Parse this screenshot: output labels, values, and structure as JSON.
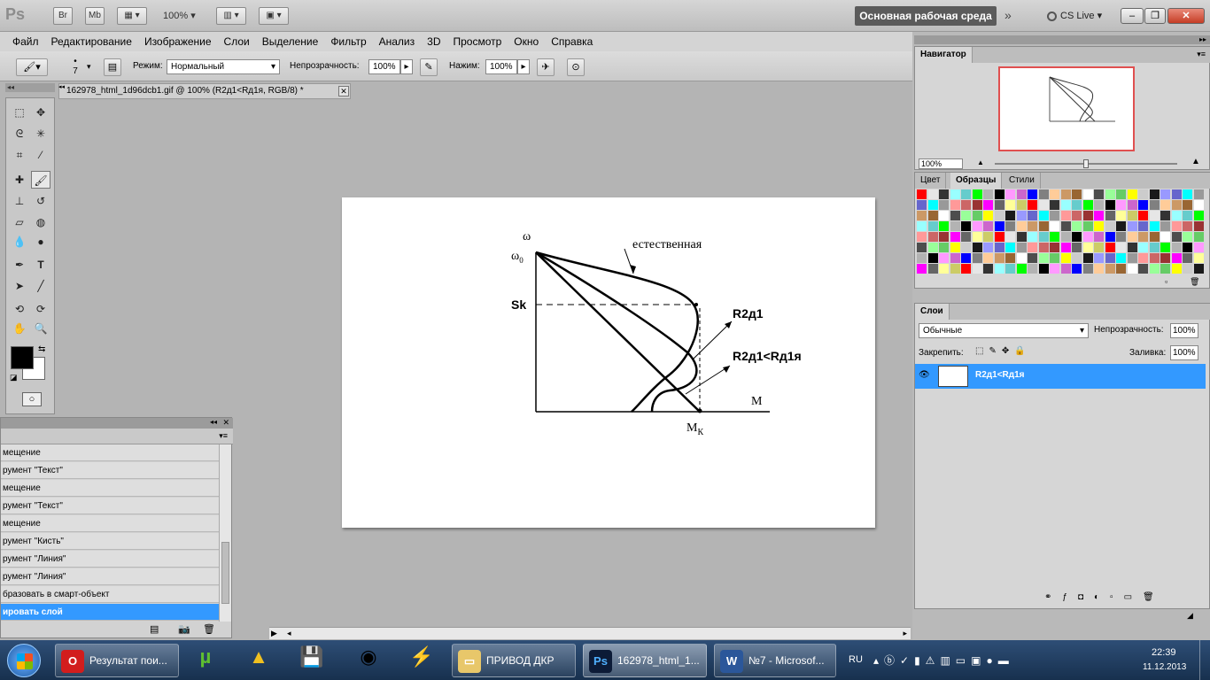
{
  "appbar": {
    "logo": "Ps",
    "btn_br": "Br",
    "btn_mb": "Mb",
    "zoom": "100%",
    "workspace": "Основная рабочая среда",
    "cslive": "CS Live"
  },
  "menu": [
    "Файл",
    "Редактирование",
    "Изображение",
    "Слои",
    "Выделение",
    "Фильтр",
    "Анализ",
    "3D",
    "Просмотр",
    "Окно",
    "Справка"
  ],
  "options": {
    "brush_size": "7",
    "mode_label": "Режим:",
    "mode_value": "Нормальный",
    "opacity_label": "Непрозрачность:",
    "opacity_value": "100%",
    "pressure_label": "Нажим:",
    "pressure_value": "100%"
  },
  "document": {
    "tab_title": "162978_html_1d96dcb1.gif @ 100% (R2д1<Rд1я, RGB/8) *"
  },
  "figure": {
    "omega": "ω",
    "omega0_main": "ω",
    "omega0_sub": "0",
    "natural": "естественная",
    "sk": "Sk",
    "r2d1": "R2д1",
    "r2d1_lt": "R2д1<Rд1я",
    "m_axis": "M",
    "mk_main": "M",
    "mk_sub": "К"
  },
  "history": {
    "items": [
      "мещение",
      "румент \"Текст\"",
      "мещение",
      "румент \"Текст\"",
      "мещение",
      "румент \"Кисть\"",
      "румент \"Линия\"",
      "румент \"Линия\"",
      "бразовать в смарт-объект",
      "ировать слой"
    ]
  },
  "navigator": {
    "tab": "Навигатор",
    "zoom": "100%"
  },
  "swatches": {
    "tabs": [
      "Цвет",
      "Образцы",
      "Стили"
    ],
    "colors": [
      "#ff0000",
      "#ffff00",
      "#00ff00",
      "#00ffff",
      "#0000ff",
      "#ff00ff",
      "#ffffff",
      "#e6e6e6",
      "#cccccc",
      "#b3b3b3",
      "#999999",
      "#808080",
      "#666666",
      "#4d4d4d",
      "#333333",
      "#1a1a1a",
      "#000000",
      "#ff9999",
      "#ffcc99",
      "#ffff99",
      "#99ff99",
      "#99ffff",
      "#9999ff",
      "#ff99ff",
      "#cc6666",
      "#cc9966",
      "#cccc66",
      "#66cc66",
      "#66cccc",
      "#6666cc",
      "#cc66cc",
      "#993333",
      "#996633"
    ]
  },
  "layers": {
    "tab": "Слои",
    "blend": "Обычные",
    "opacity_label": "Непрозрачность:",
    "opacity_value": "100%",
    "lock_label": "Закрепить:",
    "fill_label": "Заливка:",
    "fill_value": "100%",
    "layer_name": "R2д1<Rд1я"
  },
  "taskbar": {
    "opera": "Результат пои...",
    "folder": "ПРИВОД ДКР",
    "photoshop": "162978_html_1...",
    "word": "№7 - Microsof...",
    "lang": "RU",
    "time": "22:39",
    "date": "11.12.2013"
  }
}
